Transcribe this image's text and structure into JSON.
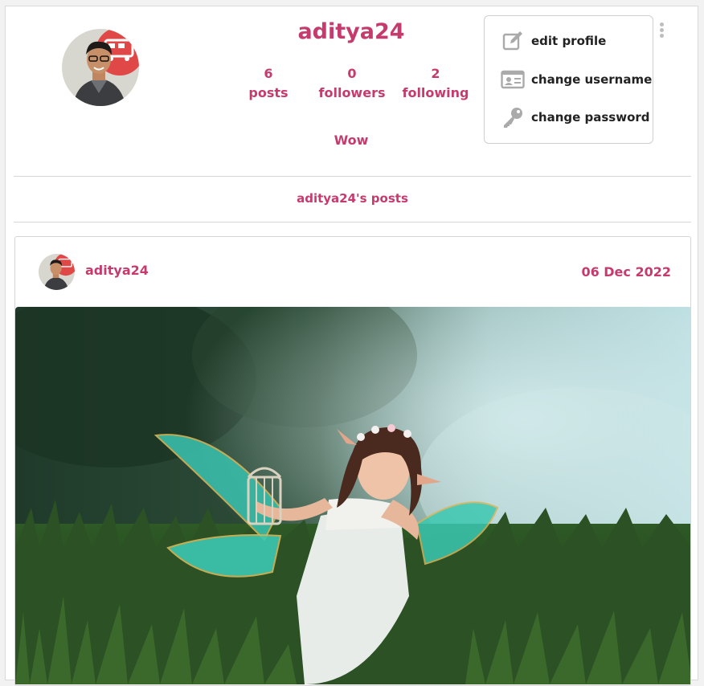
{
  "profile": {
    "username": "aditya24",
    "bio": "Wow",
    "stats": [
      {
        "count": "6",
        "label": "posts"
      },
      {
        "count": "0",
        "label": "followers"
      },
      {
        "count": "2",
        "label": "following"
      }
    ]
  },
  "menu": {
    "items": [
      {
        "label": "edit profile",
        "icon": "edit-icon"
      },
      {
        "label": "change username",
        "icon": "id-card-icon"
      },
      {
        "label": "change password",
        "icon": "key-icon"
      }
    ]
  },
  "posts_section": {
    "heading": "aditya24's posts"
  },
  "post": {
    "username": "aditya24",
    "date": "06 Dec 2022"
  },
  "colors": {
    "accent": "#c63b6d",
    "avatar_badge": "#e04848"
  }
}
